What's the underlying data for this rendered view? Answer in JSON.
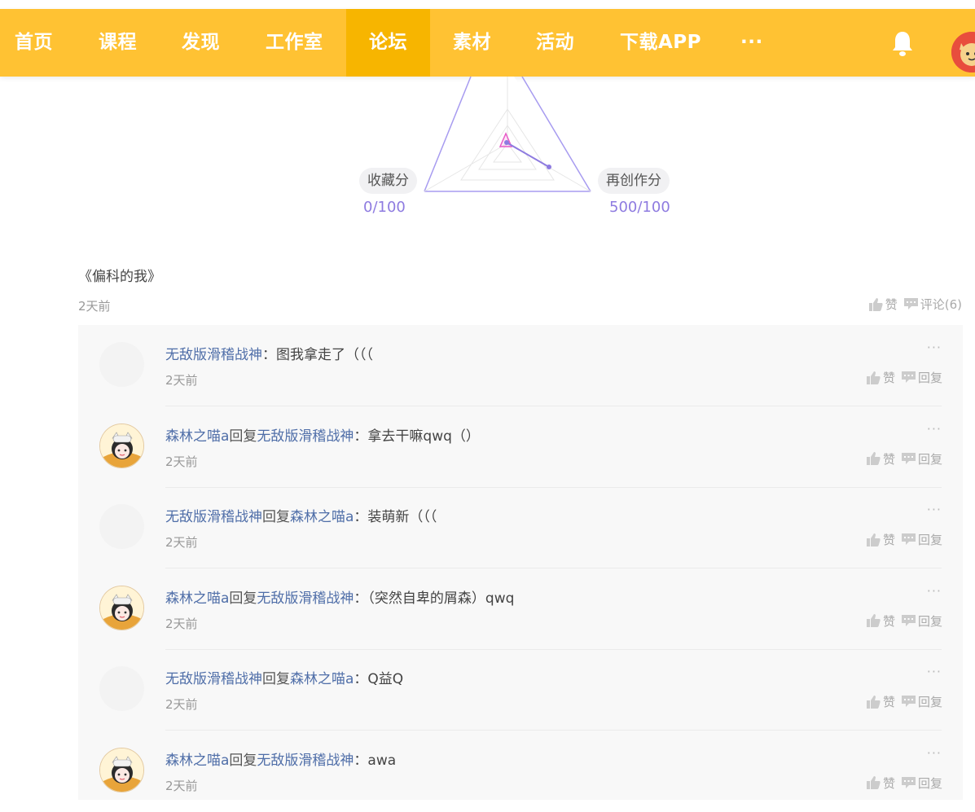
{
  "nav": {
    "items": [
      {
        "label": "首页",
        "active": false
      },
      {
        "label": "课程",
        "active": false
      },
      {
        "label": "发现",
        "active": false
      },
      {
        "label": "工作室",
        "active": false
      },
      {
        "label": "论坛",
        "active": true
      },
      {
        "label": "素材",
        "active": false
      },
      {
        "label": "活动",
        "active": false
      },
      {
        "label": "下载APP",
        "active": false
      },
      {
        "label": "···",
        "active": false
      }
    ]
  },
  "radar": {
    "left_label": "收藏分",
    "left_score": "0/100",
    "right_label": "再创作分",
    "right_score": "500/100"
  },
  "article": {
    "title": "《偏科的我》",
    "time": "2天前",
    "like_label": "赞",
    "comment_label": "评论(6)"
  },
  "comments": [
    {
      "user": "无敌版滑稽战神",
      "reply_to": "",
      "text": "图我拿走了（（（",
      "time": "2天前",
      "has_avatar": false
    },
    {
      "user": "森林之喵a",
      "reply_to": "无敌版滑稽战神",
      "text": "拿去干嘛qwq（）",
      "time": "2天前",
      "has_avatar": true
    },
    {
      "user": "无敌版滑稽战神",
      "reply_to": "森林之喵a",
      "text": "装萌新（（（",
      "time": "2天前",
      "has_avatar": false
    },
    {
      "user": "森林之喵a",
      "reply_to": "无敌版滑稽战神",
      "text": "（突然自卑的屑森）qwq",
      "time": "2天前",
      "has_avatar": true
    },
    {
      "user": "无敌版滑稽战神",
      "reply_to": "森林之喵a",
      "text": "Q益Q",
      "time": "2天前",
      "has_avatar": false
    },
    {
      "user": "森林之喵a",
      "reply_to": "无敌版滑稽战神",
      "text": "awa",
      "time": "2天前",
      "has_avatar": true
    }
  ],
  "comment_ui": {
    "reply_word": "回复",
    "colon": "：",
    "like_label": "赞",
    "reply_label": "回复",
    "more": "···"
  }
}
